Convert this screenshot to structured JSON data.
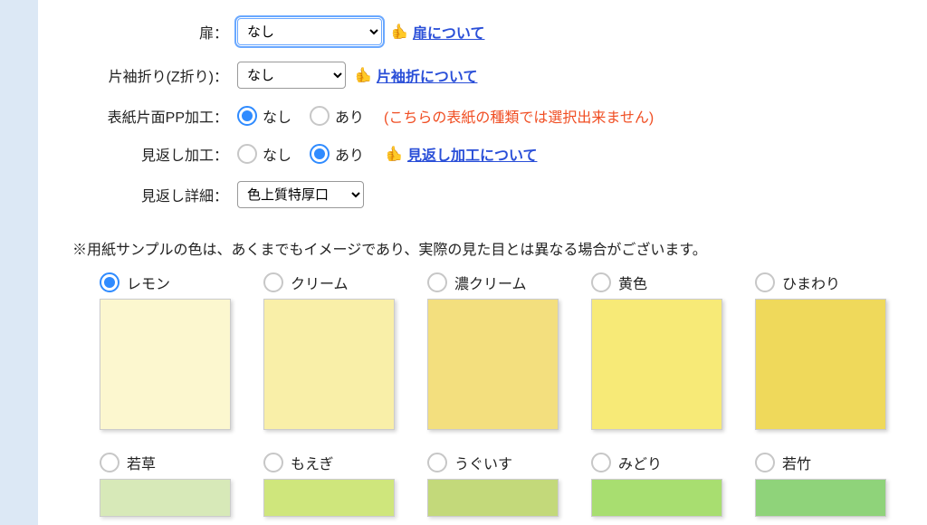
{
  "form": {
    "door": {
      "label": "扉：",
      "value": "なし",
      "link": "扉について"
    },
    "zfold": {
      "label": "片袖折り(Z折り)：",
      "value": "なし",
      "link": "片袖折について"
    },
    "pp": {
      "label": "表紙片面PP加工：",
      "none": "なし",
      "yes": "あり",
      "warning": "(こちらの表紙の種類では選択出来ません)"
    },
    "mikaeshi": {
      "label": "見返し加工：",
      "none": "なし",
      "yes": "あり",
      "link": "見返し加工について"
    },
    "mikaeshi_detail": {
      "label": "見返し詳細：",
      "value": "色上質特厚口"
    }
  },
  "note": "※用紙サンプルの色は、あくまでもイメージであり、実際の見た目とは異なる場合がございます。",
  "swatches_row1": [
    {
      "name": "レモン",
      "color": "#fcf7cf",
      "checked": true
    },
    {
      "name": "クリーム",
      "color": "#f9efa8",
      "checked": false
    },
    {
      "name": "濃クリーム",
      "color": "#f3df7e",
      "checked": false
    },
    {
      "name": "黄色",
      "color": "#f7ea77",
      "checked": false
    },
    {
      "name": "ひまわり",
      "color": "#efd95b",
      "checked": false
    }
  ],
  "swatches_row2": [
    {
      "name": "若草",
      "color": "#d7e9b8"
    },
    {
      "name": "もえぎ",
      "color": "#cfe67c"
    },
    {
      "name": "うぐいす",
      "color": "#c3d97a"
    },
    {
      "name": "みどり",
      "color": "#a8de70"
    },
    {
      "name": "若竹",
      "color": "#8fd37a"
    }
  ]
}
